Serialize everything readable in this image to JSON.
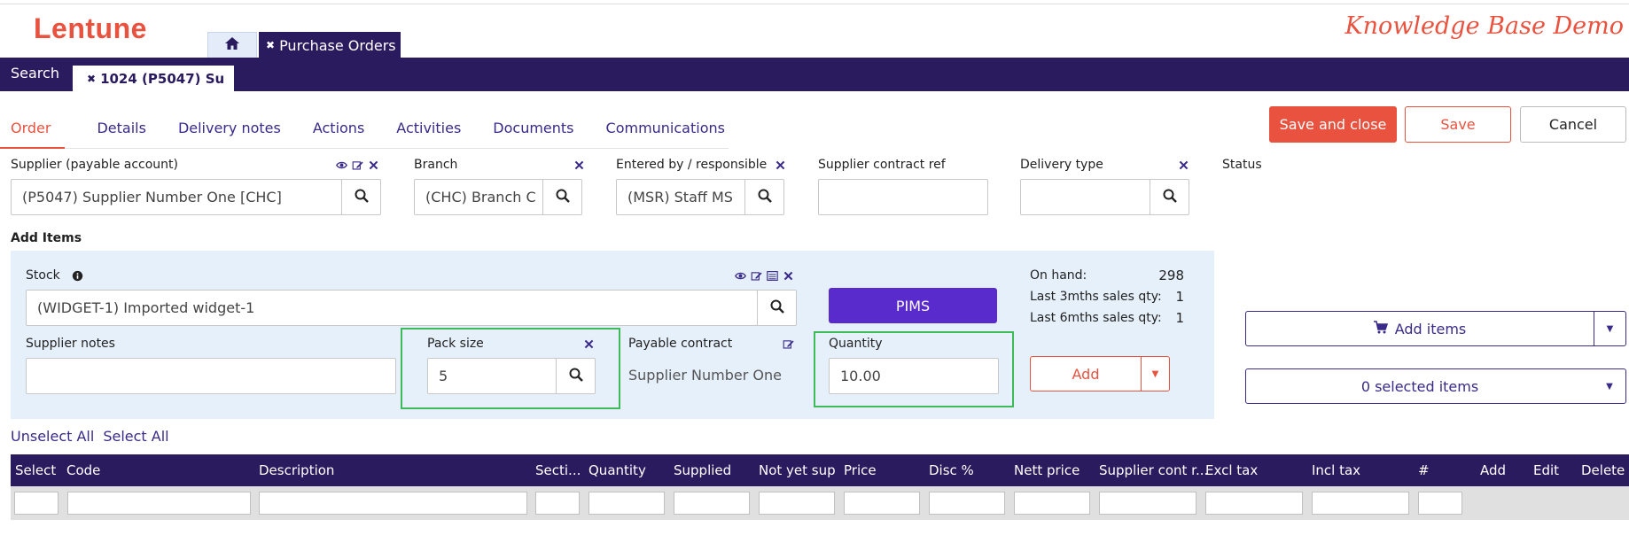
{
  "app": {
    "logo": "Lentune",
    "demo_label": "Knowledge Base Demo"
  },
  "top_tabs": {
    "purchase_orders": "Purchase Orders",
    "close_glyph": "✖"
  },
  "nav": {
    "search": "Search",
    "order_tab": "1024 (P5047) Su"
  },
  "subtabs": [
    "Order",
    "Details",
    "Delivery notes",
    "Actions",
    "Activities",
    "Documents",
    "Communications"
  ],
  "buttons": {
    "save_close": "Save and close",
    "save": "Save",
    "cancel": "Cancel"
  },
  "fields": {
    "supplier": {
      "label": "Supplier (payable account)",
      "value": "(P5047) Supplier Number One [CHC]"
    },
    "branch": {
      "label": "Branch",
      "value": "(CHC) Branch C"
    },
    "entered_by": {
      "label": "Entered by / responsible",
      "value": "(MSR) Staff MS"
    },
    "supplier_contract_ref": {
      "label": "Supplier contract ref",
      "value": ""
    },
    "delivery_type": {
      "label": "Delivery type",
      "value": ""
    },
    "status": {
      "label": "Status"
    }
  },
  "add_items": {
    "title": "Add Items",
    "stock": {
      "label": "Stock",
      "value": "(WIDGET-1) Imported widget-1"
    },
    "pims_label": "PIMS",
    "supplier_notes": {
      "label": "Supplier notes",
      "value": ""
    },
    "pack_size": {
      "label": "Pack size",
      "value": "5"
    },
    "payable_contract": {
      "label": "Payable contract",
      "value": "Supplier Number One"
    },
    "quantity": {
      "label": "Quantity",
      "value": "10.00"
    },
    "stats": [
      {
        "label": "On hand:",
        "value": "298"
      },
      {
        "label": "Last 3mths sales qty:",
        "value": "1"
      },
      {
        "label": "Last 6mths sales qty:",
        "value": "1"
      }
    ],
    "add_label": "Add"
  },
  "right_panel": {
    "add_items": "Add items",
    "selected_items": "0 selected items"
  },
  "links": {
    "unselect_all": "Unselect All",
    "select_all": "Select All"
  },
  "table": {
    "columns": [
      "Select",
      "Code",
      "Description",
      "Secti...",
      "Quantity",
      "Supplied",
      "Not yet sup",
      "Price",
      "Disc %",
      "Nett price",
      "Supplier cont r...",
      "Excl tax",
      "Incl tax",
      "#",
      "Add",
      "Edit",
      "Delete"
    ]
  },
  "colors": {
    "brand_red": "#e8523f",
    "navy": "#2a1a5e",
    "purple": "#5a2bcc",
    "panel_bg": "#e6f0fb",
    "highlight_green": "#3dba5a"
  }
}
